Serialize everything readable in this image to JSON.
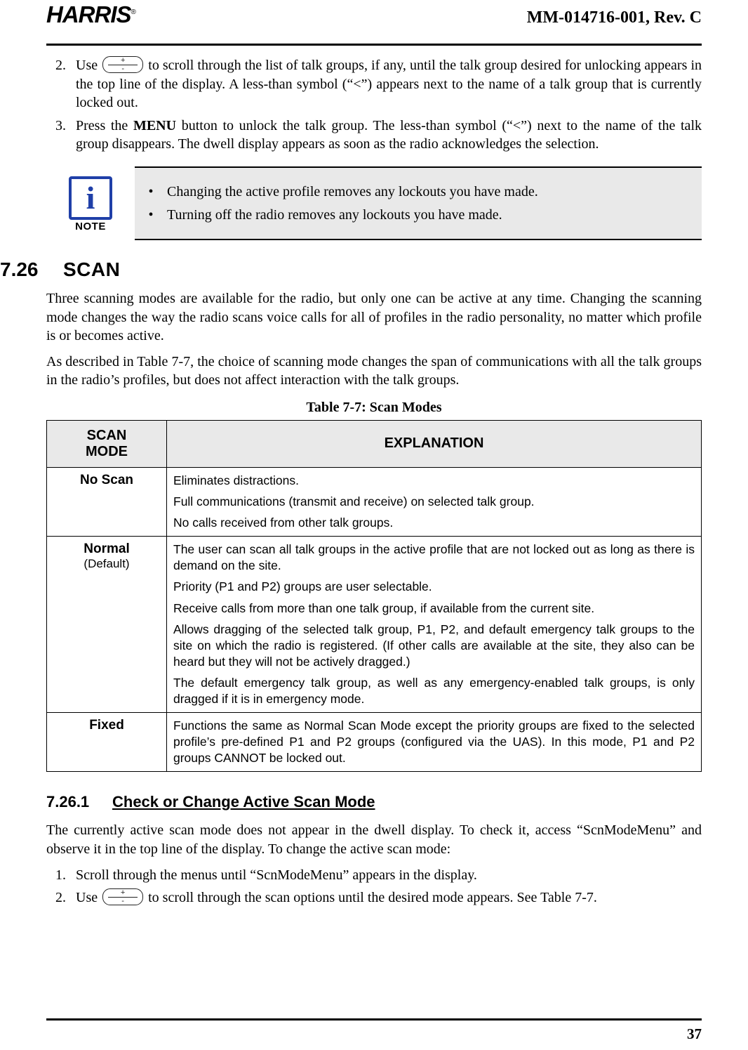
{
  "header": {
    "logo_text": "HARRIS",
    "logo_registered": "®",
    "document_number": "MM-014716-001, Rev. C"
  },
  "steps_top": [
    {
      "number": "2.",
      "prefix": "Use",
      "icon": "volume-rocker-icon",
      "suffix": "to scroll through the list of talk groups, if any, until the talk group desired for unlocking appears in the top line of the display. A less-than symbol (“<”) appears next to the name of a talk group that is currently locked out."
    },
    {
      "number": "3.",
      "prefix": "Press the",
      "bold_word": "MENU",
      "suffix": "button to unlock the talk group. The less-than symbol (“<”) next to the name of the talk group disappears. The dwell display appears as soon as the radio acknowledges the selection."
    }
  ],
  "note": {
    "label": "NOTE",
    "icon": "info-icon",
    "glyph": "i",
    "bullets": [
      "Changing the active profile removes any lockouts you have made.",
      "Turning off the radio removes any lockouts you have made."
    ]
  },
  "section": {
    "number": "7.26",
    "title": "SCAN",
    "paragraphs": [
      "Three scanning modes are available for the radio, but only one can be active at any time. Changing the scanning mode changes the way the radio scans voice calls for all of profiles in the radio personality, no matter which profile is or becomes active.",
      "As described in Table 7-7, the choice of scanning mode changes the span of communications with all the talk groups in the radio’s profiles, but does not affect interaction with the talk groups."
    ]
  },
  "table": {
    "caption": "Table 7-7: Scan Modes",
    "headers": [
      "SCAN MODE",
      "EXPLANATION"
    ],
    "header_mode_line1": "SCAN",
    "header_mode_line2": "MODE",
    "rows": [
      {
        "mode": "No Scan",
        "mode_sub": "",
        "explanation": [
          "Eliminates distractions.",
          "Full communications (transmit and receive) on selected talk group.",
          "No calls received from other talk groups."
        ]
      },
      {
        "mode": "Normal",
        "mode_sub": "(Default)",
        "explanation": [
          "The user can scan all talk groups in the active profile that are not locked out as long as there is demand on the site.",
          "Priority (P1 and P2) groups are user selectable.",
          "Receive calls from more than one talk group, if available from the current site.",
          "Allows dragging of the selected talk group, P1, P2, and default emergency talk groups to the site on which the radio is registered. (If other calls are available at the site, they also can be heard but they will not be actively dragged.)",
          "The default emergency talk group, as well as any emergency-enabled talk groups, is only dragged if it is in emergency mode."
        ]
      },
      {
        "mode": "Fixed",
        "mode_sub": "",
        "explanation": [
          "Functions the same as Normal Scan Mode except the priority groups are fixed to the selected profile’s pre-defined P1 and P2 groups (configured via the UAS). In this mode, P1 and P2 groups CANNOT be locked out."
        ]
      }
    ]
  },
  "subsection": {
    "number": "7.26.1",
    "title": "Check or Change Active Scan Mode",
    "paragraph": "The currently active scan mode does not appear in the dwell display. To check it, access “ScnModeMenu” and observe it in the top line of the display. To change the active scan mode:",
    "steps": [
      {
        "number": "1.",
        "text": "Scroll through the menus until “ScnModeMenu” appears in the display."
      },
      {
        "number": "2.",
        "prefix": "Use",
        "icon": "volume-rocker-icon",
        "suffix": "to scroll through the scan options until the desired mode appears. See Table 7-7."
      }
    ]
  },
  "footer": {
    "page_number": "37"
  },
  "colors": {
    "note_icon_blue": "#1f3fa8",
    "table_header_gray": "#e9e9e9",
    "note_background": "#e9e9e9"
  }
}
